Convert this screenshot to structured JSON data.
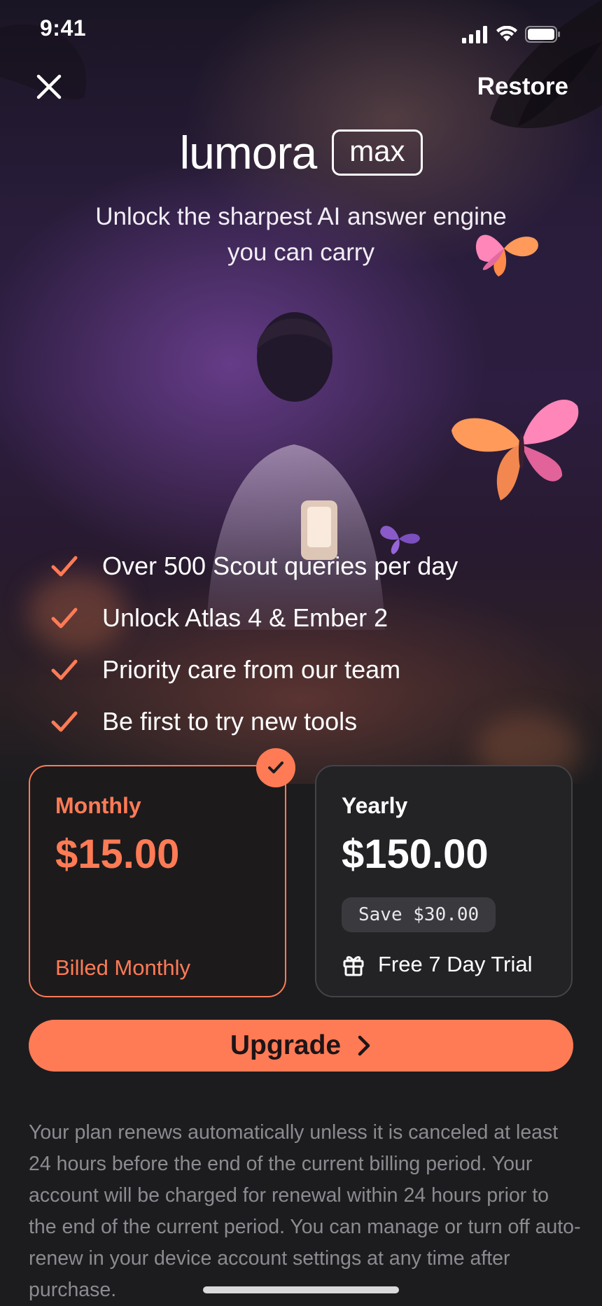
{
  "status_bar": {
    "time": "9:41"
  },
  "header": {
    "restore_label": "Restore"
  },
  "brand": {
    "name": "lumora",
    "badge": "max"
  },
  "subtitle": {
    "line1": "Unlock the sharpest AI answer engine",
    "line2": "you can carry"
  },
  "features": [
    "Over 500 Scout queries per day",
    "Unlock Atlas 4 & Ember 2",
    "Priority care from our team",
    "Be first to try new tools"
  ],
  "plans": {
    "monthly": {
      "name": "Monthly",
      "price": "$15.00",
      "billing": "Billed Monthly",
      "selected": true
    },
    "yearly": {
      "name": "Yearly",
      "price": "$150.00",
      "savings": "Save $30.00",
      "trial": "Free 7 Day Trial",
      "selected": false
    }
  },
  "cta": {
    "label": "Upgrade"
  },
  "legal": {
    "text": "Your plan renews automatically unless it is canceled at least 24 hours before the end of the current billing period. Your account will be charged for renewal within 24 hours prior to the end of the current period. You can manage or turn off auto-renew in your device account settings at any time after purchase."
  },
  "colors": {
    "accent": "#ff7b55",
    "background": "#1c1c1f",
    "card_dark": "#232326",
    "legal_text": "#8b8b90"
  }
}
